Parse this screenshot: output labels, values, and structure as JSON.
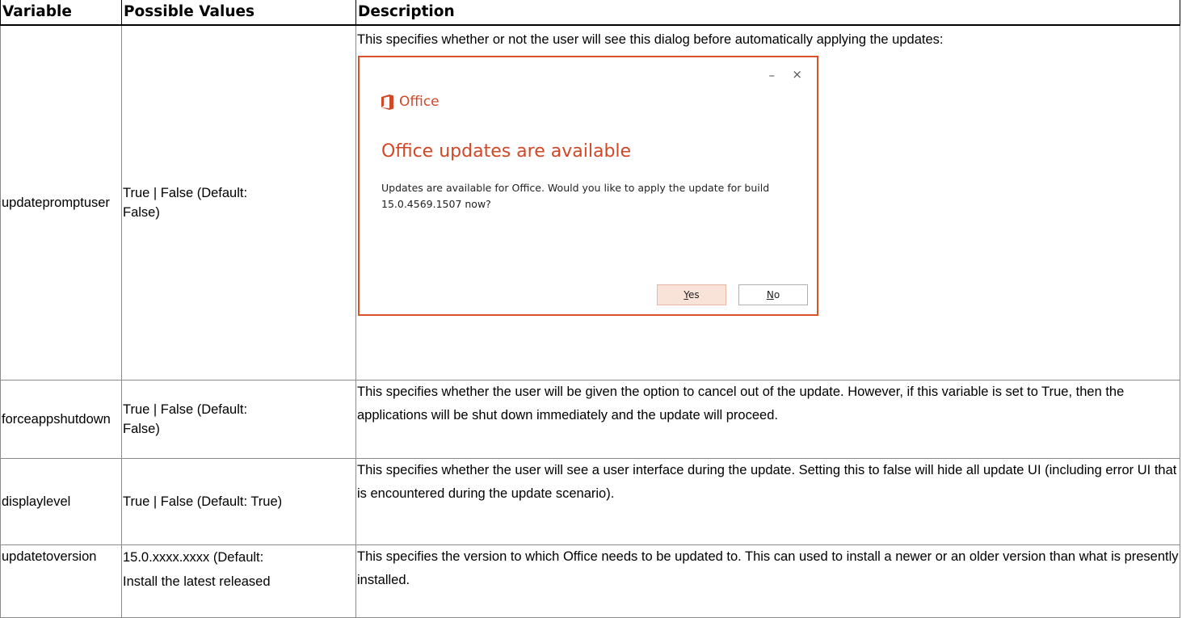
{
  "table": {
    "headers": [
      "Variable",
      "Possible Values",
      "Description"
    ],
    "rows": [
      {
        "variable": "updatepromptuser",
        "values": "True | False  (Default: False)",
        "description": "This specifies whether or not the user will see this dialog before automatically applying the updates:"
      },
      {
        "variable": "forceappshutdown",
        "values": "True | False  (Default: False)",
        "description": "This specifies whether the user will be given the option to cancel out of the update. However, if this variable is set to True, then the applications will be shut down immediately and the update will proceed."
      },
      {
        "variable": "displaylevel",
        "values": "True | False  (Default: True)",
        "description": "This specifies whether the user will see a user interface during the update. Setting this to false will hide all update UI (including error UI that is encountered during the update scenario)."
      },
      {
        "variable": "updatetoversion",
        "values": "15.0.xxxx.xxxx  (Default: Install the latest released",
        "description": "This specifies the version to which Office needs to be updated to.  This can used to install a newer or an older version than what is presently installed."
      }
    ]
  },
  "dialog": {
    "minimize_glyph": "–",
    "close_glyph": "×",
    "brand": "Office",
    "heading": "Office updates are available",
    "message": "Updates are available for Office. Would you like to apply the update for build 15.0.4569.1507 now?",
    "yes_access": "Y",
    "yes_rest": "es",
    "no_access": "N",
    "no_rest": "o",
    "accent_color": "#d24726",
    "border_color": "#d7542a"
  }
}
